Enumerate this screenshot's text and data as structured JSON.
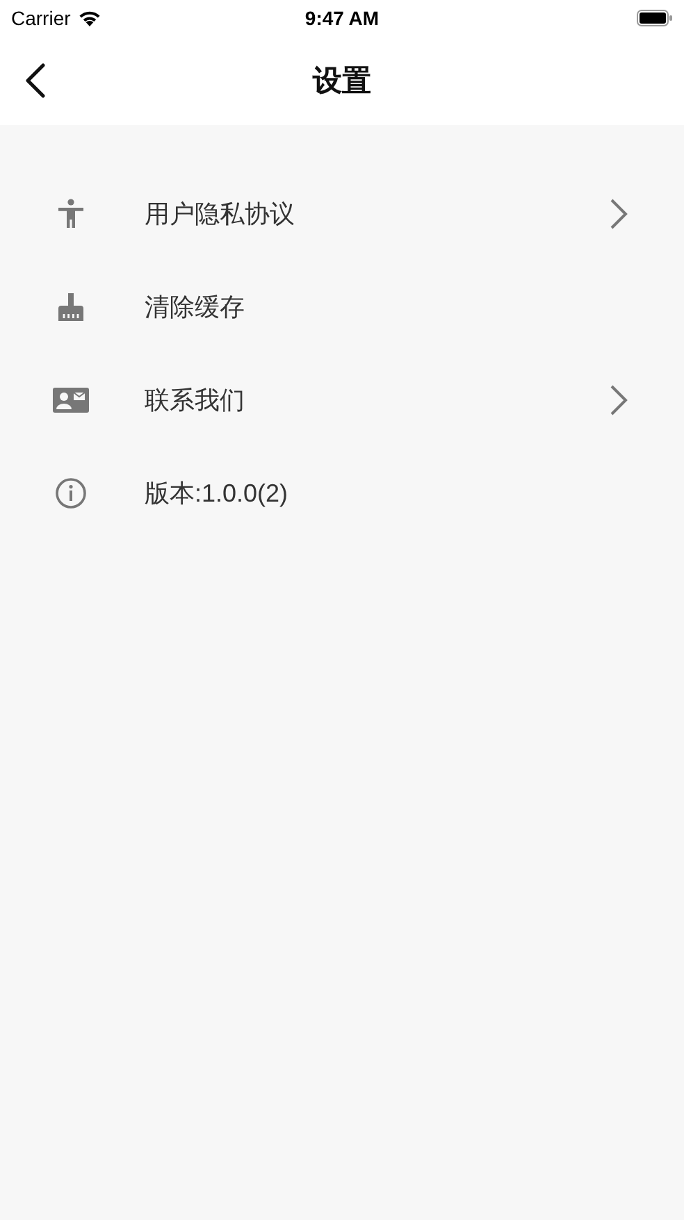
{
  "status_bar": {
    "carrier": "Carrier",
    "time": "9:47 AM"
  },
  "nav_bar": {
    "title": "设置"
  },
  "items": [
    {
      "kind": "accessibility",
      "label": "用户隐私协议",
      "chevron": true
    },
    {
      "kind": "brush",
      "label": "清除缓存",
      "chevron": false
    },
    {
      "kind": "contact",
      "label": "联系我们",
      "chevron": true
    },
    {
      "kind": "info",
      "label": "版本:1.0.0(2)",
      "chevron": false
    }
  ]
}
